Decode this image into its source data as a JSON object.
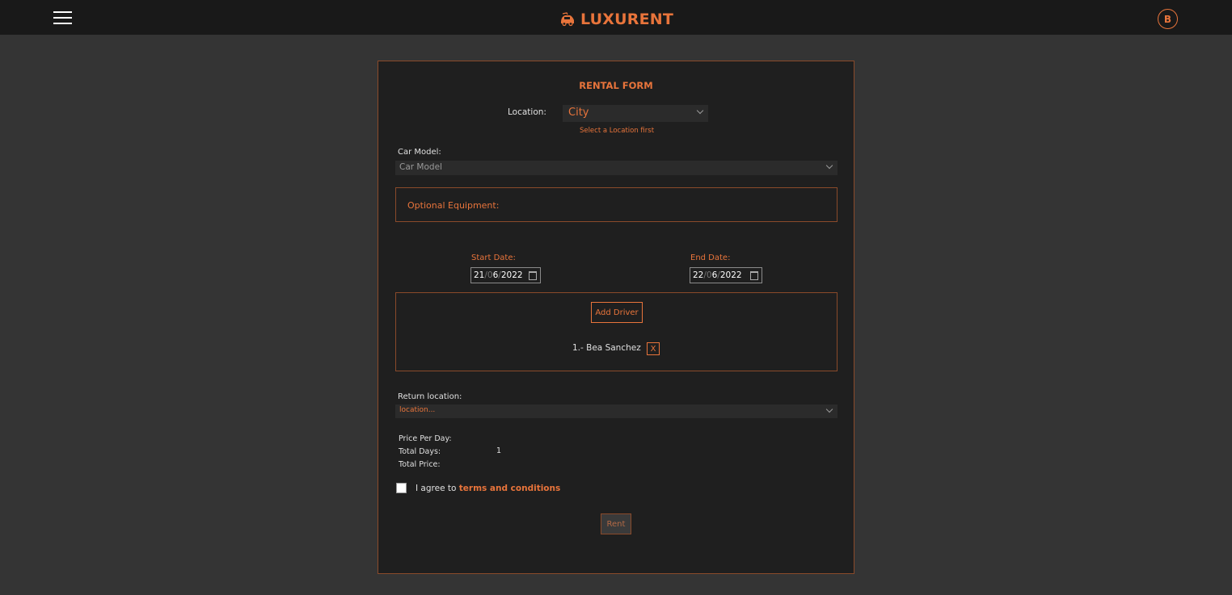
{
  "navbar": {
    "brand": "LUXURENT",
    "avatar_initial": "B"
  },
  "form": {
    "title": "RENTAL FORM",
    "location_label": "Location:",
    "location_value": "City",
    "location_hint": "Select a Location first",
    "car_model_label": "Car Model:",
    "car_model_value": "Car Model",
    "optional_equipment_label": "Optional Equipment:",
    "start_date_label": "Start Date:",
    "start_date": {
      "day": "21",
      "month_lead": "0",
      "month": "6",
      "year": "2022"
    },
    "end_date_label": "End Date:",
    "end_date": {
      "day": "22",
      "month_lead": "0",
      "month": "6",
      "year": "2022"
    },
    "add_driver_label": "Add Driver",
    "drivers": [
      {
        "name": "1.- Bea Sanchez",
        "remove_label": "X"
      }
    ],
    "return_location_label": "Return location:",
    "return_location_value": "location...",
    "price_per_day_label": "Price Per Day:",
    "total_days_label": "Total Days:",
    "total_days_value": "1",
    "total_price_label": "Total Price:",
    "agree_prefix": "I agree to ",
    "terms_link": "terms and conditions",
    "rent_label": "Rent"
  },
  "colors": {
    "accent": "#e8743b",
    "background": "#343434",
    "panel": "#1f1f1f",
    "navbar": "#191919"
  },
  "icons": [
    "menu-icon",
    "car-logo-icon",
    "chevron-down-icon",
    "calendar-icon"
  ]
}
